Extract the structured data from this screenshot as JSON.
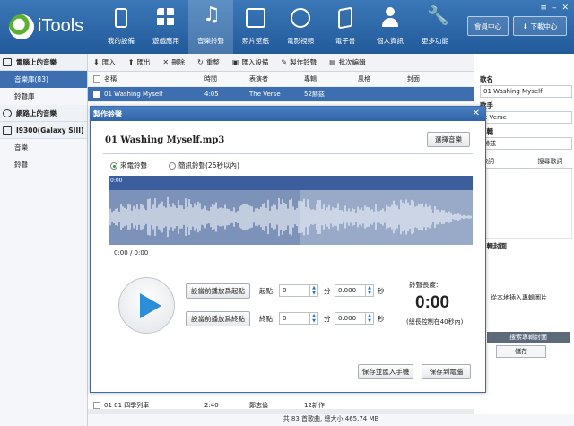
{
  "header": {
    "app_name": "iTools",
    "nav": [
      {
        "label": "我的設備",
        "icon": "phone-icon"
      },
      {
        "label": "遊戲應用",
        "icon": "apps-icon"
      },
      {
        "label": "音樂鈴聲",
        "icon": "music-note-icon"
      },
      {
        "label": "照片壁紙",
        "icon": "photo-icon"
      },
      {
        "label": "電影視頻",
        "icon": "video-play-icon"
      },
      {
        "label": "電子書",
        "icon": "book-icon"
      },
      {
        "label": "個人資訊",
        "icon": "user-icon"
      },
      {
        "label": "更多功能",
        "icon": "wrench-icon"
      }
    ],
    "member_center": "會員中心",
    "download_center": "下載中心"
  },
  "sidebar": {
    "local_header": "電腦上的音樂",
    "local_items": [
      "音樂庫(83)",
      "鈴聲庫"
    ],
    "web_header": "網路上的音樂",
    "device_header": "I9300(Galaxy SIII)",
    "device_items": [
      "音樂",
      "鈴聲"
    ]
  },
  "toolbar": [
    "匯入",
    "匯出",
    "刪除",
    "重整",
    "匯入設備",
    "製作鈴聲",
    "批次編輯"
  ],
  "table": {
    "columns": [
      "名稱",
      "時間",
      "表演者",
      "專輯",
      "風格",
      "封面"
    ],
    "selected_row": {
      "name": "01 Washing Myself",
      "time": "4:05",
      "artist": "The Verse",
      "album": "52赫兹"
    },
    "bottom_row": {
      "name": "01 01 四季列車",
      "time": "2:40",
      "artist": "鄭志倫",
      "album": "12新作"
    }
  },
  "status": "共 83 首歌曲, 總大小 465.74 MB",
  "right_panel": {
    "name_label": "歌名",
    "name_value": "01 Washing Myself",
    "artist_label": "歌手",
    "artist_value": "e Verse",
    "album_label": "專輯",
    "album_value": "赫兹",
    "lyrics_label": "歌詞",
    "search_lyrics": "搜尋歌詞",
    "cover_label": "專輯封面",
    "upload_cover": "從本地插入專輯圖片",
    "search_cover": "搜索專輯封面",
    "save": "儲存"
  },
  "dialog": {
    "title": "製作鈴聲",
    "file": "01 Washing Myself.mp3",
    "choose_btn": "選擇音樂",
    "radio_incoming": "來電鈴聲",
    "radio_sms": "簡訊鈴聲(25秒以內)",
    "wave_time": "0:00",
    "position": "0:00 / 0:00",
    "set_start_btn": "設當前播放爲起點",
    "set_end_btn": "設當前播放爲終點",
    "start_label": "起點:",
    "end_label": "終點:",
    "min_unit": "分",
    "sec_unit": "秒",
    "start_min": "0",
    "start_sec": "0.000",
    "end_min": "0",
    "end_sec": "0.000",
    "length_label": "鈴聲長度:",
    "length_value": "0:00",
    "length_limit": "(總長控制在40秒內)",
    "save_import_btn": "保存並匯入手機",
    "save_pc_btn": "保存到電腦"
  }
}
